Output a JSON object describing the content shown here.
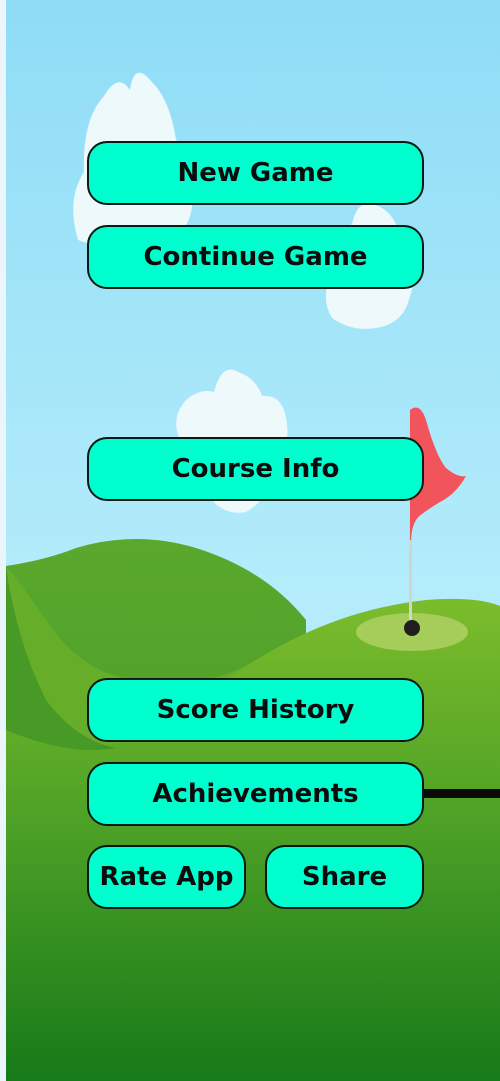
{
  "menu": {
    "new_game": "New Game",
    "continue_game": "Continue Game",
    "course_info": "Course Info",
    "score_history": "Score History",
    "achievements": "Achievements",
    "rate_app": "Rate App",
    "share": "Share"
  },
  "colors": {
    "button_fill": "#00ffcf",
    "button_border": "#0b1a14",
    "sky": "#8fdcf6",
    "hill_light": "#78b82a",
    "hill_dark": "#1c7d1a",
    "flag": "#f2545b",
    "green_patch": "#a6cc5a"
  },
  "icons": [
    "cloud-decoration",
    "golf-flag-icon",
    "golf-hole-icon"
  ]
}
